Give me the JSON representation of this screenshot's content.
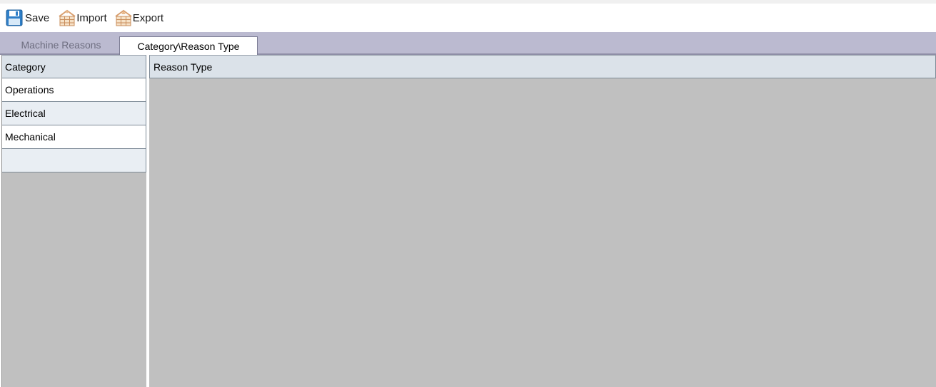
{
  "toolbar": {
    "save_label": "Save",
    "import_label": "Import",
    "export_label": "Export",
    "icons": {
      "save": "save-floppy-icon",
      "import": "import-table-icon",
      "export": "export-table-icon"
    }
  },
  "tabs": [
    {
      "label": "Machine Reasons",
      "active": false
    },
    {
      "label": "Category\\Reason Type",
      "active": true
    }
  ],
  "category_grid": {
    "header": "Category",
    "rows": [
      "Operations",
      "Electrical",
      "Mechanical"
    ],
    "new_row": ""
  },
  "reason_grid": {
    "header": "Reason Type",
    "rows": []
  },
  "colors": {
    "tab_strip": "#bbbad0",
    "grid_header": "#dbe2e9",
    "grid_alt_row": "#e9eef3",
    "empty_area": "#c0c0c0"
  }
}
